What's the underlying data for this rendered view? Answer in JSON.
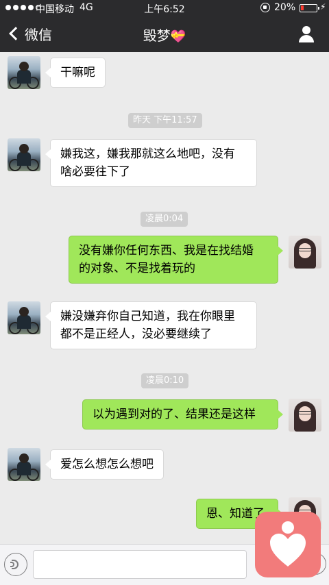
{
  "status_bar": {
    "carrier": "中国移动",
    "network": "4G",
    "time": "上午6:52",
    "battery_percent": "20%",
    "battery_level": 0.2,
    "battery_color": "#ff3b30"
  },
  "nav": {
    "back_label": "微信",
    "title": "毁梦",
    "title_emoji": "💝"
  },
  "messages": [
    {
      "sender": "other",
      "text": "干嘛呢"
    },
    {
      "type": "time",
      "text": "昨天 下午11:57"
    },
    {
      "sender": "other",
      "text_lines": [
        "嫌我这，嫌我那就这么地吧，没有",
        "啥必要往下了"
      ]
    },
    {
      "type": "time",
      "text": "凌晨0:04"
    },
    {
      "sender": "self",
      "text_lines": [
        "没有嫌你任何东西、我是在找结婚",
        "的对象、不是找着玩的"
      ]
    },
    {
      "sender": "other",
      "text_lines": [
        "嫌没嫌弃你自己知道，我在你眼里",
        "都不是正经人，没必要继续了"
      ]
    },
    {
      "type": "time",
      "text": "凌晨0:10"
    },
    {
      "sender": "self",
      "text": "以为遇到对的了、结果还是这样"
    },
    {
      "sender": "other",
      "text": "爱怎么想怎么想吧"
    },
    {
      "sender": "self",
      "text": "恩、知道了"
    }
  ],
  "colors": {
    "outgoing_bubble": "#a0e75a",
    "incoming_bubble": "#ffffff",
    "header_bg": "#2b2b2d",
    "badge": "#f27b7b"
  },
  "icons": {
    "back": "chevron-left-icon",
    "profile": "person-icon",
    "voice": "voice-icon",
    "plus": "plus-circle-icon",
    "badge": "heart-badge-icon"
  }
}
